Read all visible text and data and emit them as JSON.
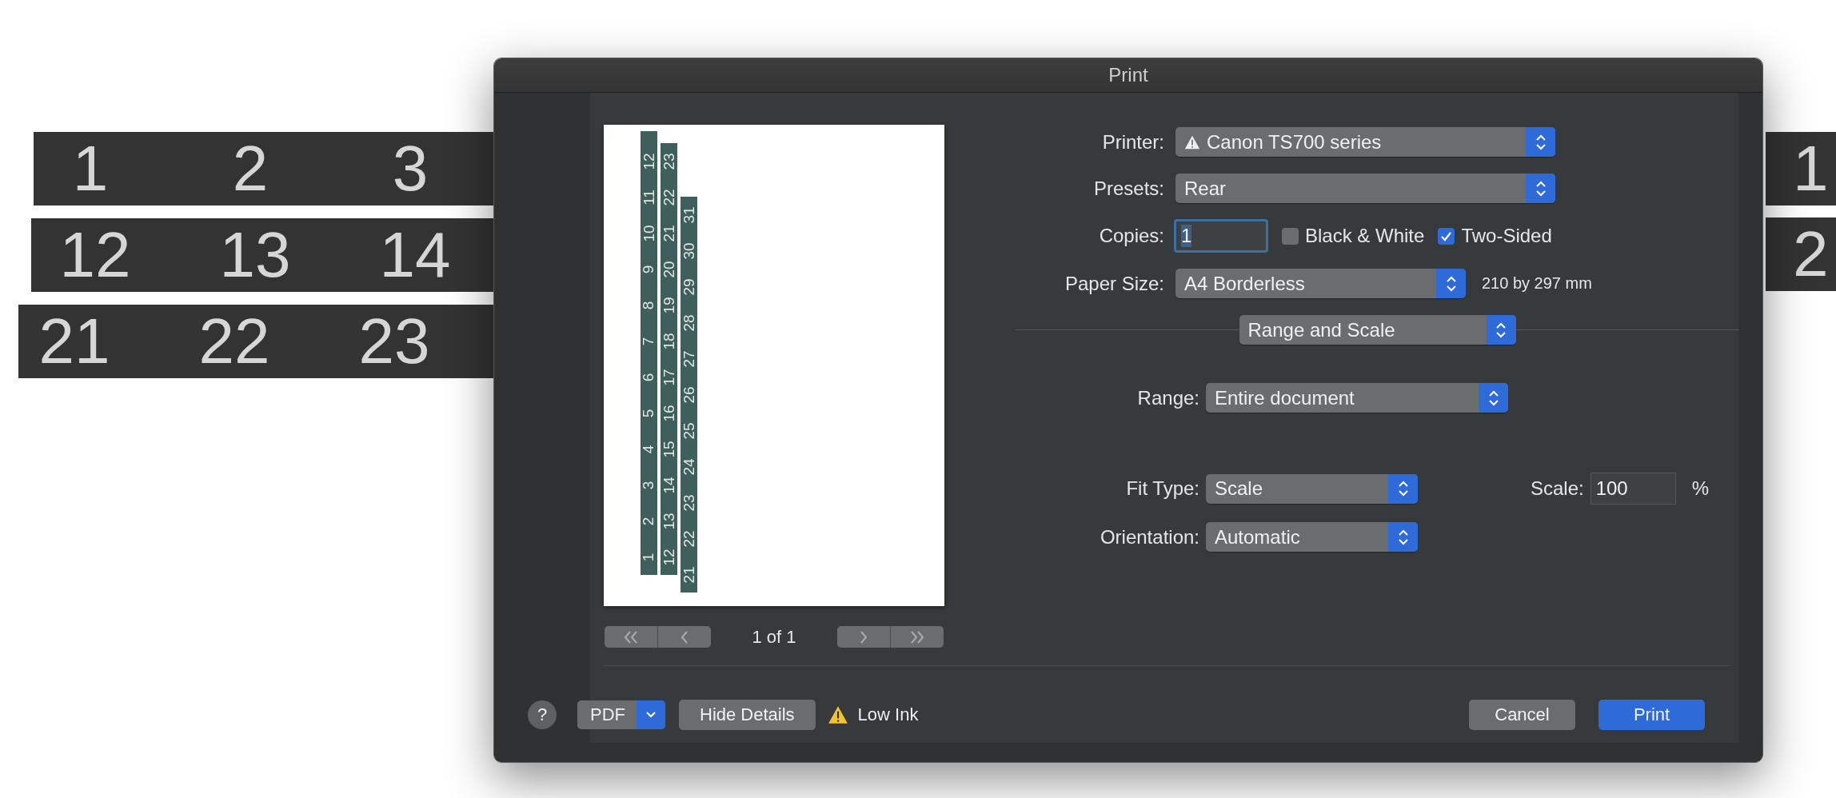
{
  "page": {
    "strips_left": [
      {
        "numbers": [
          "1",
          "2",
          "3"
        ]
      },
      {
        "numbers": [
          "12",
          "13",
          "14"
        ]
      },
      {
        "numbers": [
          "21",
          "22",
          "23"
        ]
      }
    ],
    "strips_right": [
      {
        "numbers": [
          "1"
        ]
      },
      {
        "numbers": [
          "2"
        ]
      }
    ]
  },
  "dialog": {
    "title": "Print",
    "preview": {
      "strips": [
        {
          "numbers": [
            "1",
            "2",
            "3",
            "4",
            "5",
            "6",
            "7",
            "8",
            "9",
            "10",
            "11",
            "12"
          ]
        },
        {
          "numbers": [
            "12",
            "13",
            "14",
            "15",
            "16",
            "17",
            "18",
            "19",
            "20",
            "21",
            "22",
            "23"
          ]
        },
        {
          "numbers": [
            "21",
            "22",
            "23",
            "24",
            "25",
            "26",
            "27",
            "28",
            "29",
            "30",
            "31"
          ]
        }
      ],
      "page_indicator": "1 of 1"
    },
    "printer": {
      "label": "Printer:",
      "value": "Canon TS700 series"
    },
    "presets": {
      "label": "Presets:",
      "value": "Rear"
    },
    "copies": {
      "label": "Copies:",
      "value": "1",
      "focused": true
    },
    "options": [
      {
        "label": "Black & White",
        "checked": false
      },
      {
        "label": "Two-Sided",
        "checked": true
      }
    ],
    "paper_size": {
      "label": "Paper Size:",
      "value": "A4 Borderless",
      "dimensions": "210 by 297 mm"
    },
    "section": {
      "value": "Range and Scale"
    },
    "range": {
      "label": "Range:",
      "value": "Entire document"
    },
    "fit_type": {
      "label": "Fit Type:",
      "value": "Scale"
    },
    "scale": {
      "label": "Scale:",
      "value": "100",
      "unit": "%"
    },
    "orientation": {
      "label": "Orientation:",
      "value": "Automatic"
    },
    "footer": {
      "help": "?",
      "pdf": "PDF",
      "details": "Hide Details",
      "status": "Low Ink",
      "buttons": [
        {
          "label": "Cancel",
          "kind": "secondary"
        },
        {
          "label": "Print",
          "kind": "primary"
        }
      ]
    }
  }
}
